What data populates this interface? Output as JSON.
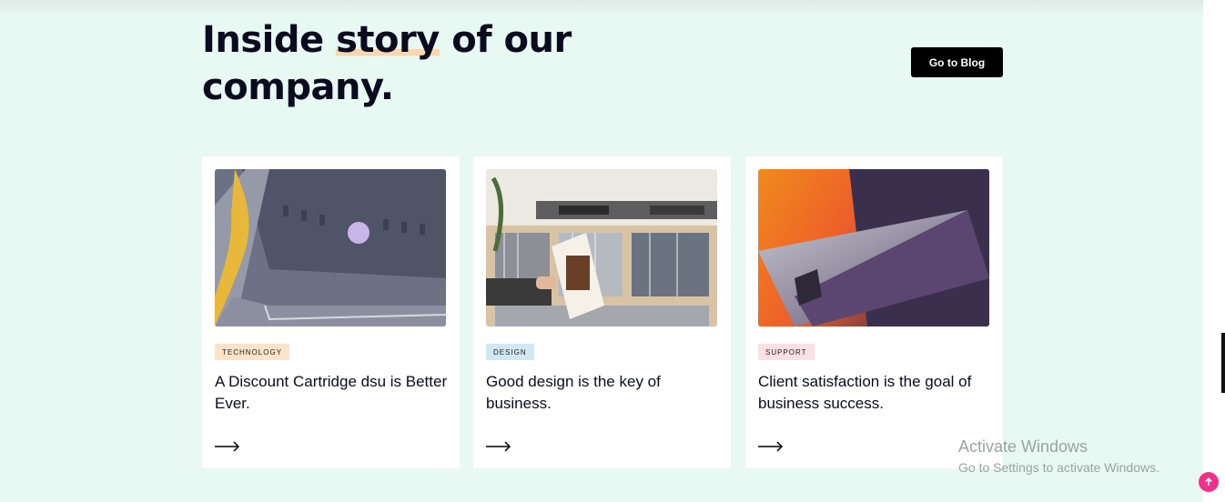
{
  "section": {
    "heading_prefix": "Inside ",
    "heading_highlight": "story",
    "heading_suffix": " of our company.",
    "blog_button_label": "Go to Blog"
  },
  "cards": [
    {
      "tag": "TECHNOLOGY",
      "tag_color": "#fde3c8",
      "title": "A Discount Cartridge dsu is Better Ever.",
      "image": "building-reflection-image"
    },
    {
      "tag": "DESIGN",
      "tag_color": "#cfe8f3",
      "title": "Good design is the key of business.",
      "image": "vinyl-records-image"
    },
    {
      "tag": "SUPPORT",
      "tag_color": "#fde0e3",
      "title": "Client satisfaction is the goal of business success.",
      "image": "abstract-geometric-image"
    }
  ],
  "watermark": {
    "line1": "Activate Windows",
    "line2": "Go to Settings to activate Windows."
  },
  "colors": {
    "background": "#e8f8f2",
    "highlight": "#f7d7b0",
    "scroll_top_button": "#f0308a"
  }
}
